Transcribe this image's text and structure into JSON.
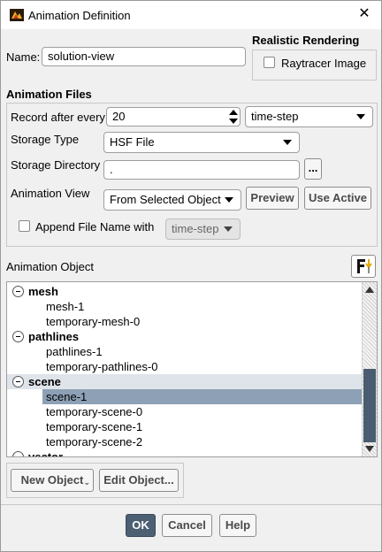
{
  "window": {
    "title": "Animation Definition",
    "close_icon": "close-icon",
    "app_icon": "fluent-app-icon"
  },
  "name": {
    "label": "Name:",
    "value": "solution-view"
  },
  "realistic_rendering": {
    "heading": "Realistic Rendering",
    "raytracer_label": "Raytracer Image",
    "raytracer_checked": false
  },
  "animation_files": {
    "heading": "Animation Files",
    "record_label": "Record after every",
    "record_value": "20",
    "record_unit": "time-step",
    "storage_type_label": "Storage Type",
    "storage_type_value": "HSF File",
    "storage_dir_label": "Storage Directory",
    "storage_dir_value": ".",
    "browse_label": "...",
    "animation_view_label": "Animation View",
    "animation_view_value": "From Selected Object",
    "preview_label": "Preview",
    "use_active_label": "Use Active",
    "append_label": "Append File Name with",
    "append_checked": false,
    "append_value": "time-step"
  },
  "animation_object": {
    "label": "Animation Object",
    "filter_icon": "filter-icon",
    "tree": [
      {
        "group": "mesh",
        "items": [
          "mesh-1",
          "temporary-mesh-0"
        ]
      },
      {
        "group": "pathlines",
        "items": [
          "pathlines-1",
          "temporary-pathlines-0"
        ]
      },
      {
        "group": "scene",
        "items": [
          "scene-1",
          "temporary-scene-0",
          "temporary-scene-1",
          "temporary-scene-2"
        ]
      },
      {
        "group": "vector",
        "items": []
      }
    ],
    "selected_item": "scene-1",
    "new_object_label": "New Object",
    "edit_object_label": "Edit Object..."
  },
  "footer": {
    "ok_label": "OK",
    "cancel_label": "Cancel",
    "help_label": "Help"
  },
  "colors": {
    "selection": "#8da0b5",
    "group_highlight": "#dfe4ea",
    "scroll_thumb": "#4a5c6f"
  }
}
